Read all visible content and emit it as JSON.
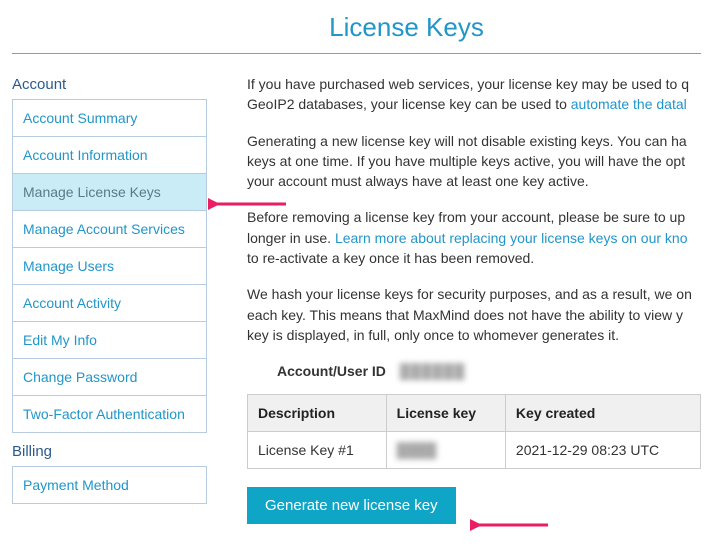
{
  "page": {
    "title": "License Keys"
  },
  "sidebar": {
    "sections": [
      {
        "label": "Account",
        "items": [
          {
            "label": "Account Summary",
            "active": false
          },
          {
            "label": "Account Information",
            "active": false
          },
          {
            "label": "Manage License Keys",
            "active": true
          },
          {
            "label": "Manage Account Services",
            "active": false
          },
          {
            "label": "Manage Users",
            "active": false
          },
          {
            "label": "Account Activity",
            "active": false
          },
          {
            "label": "Edit My Info",
            "active": false
          },
          {
            "label": "Change Password",
            "active": false
          },
          {
            "label": "Two-Factor Authentication",
            "active": false
          }
        ]
      },
      {
        "label": "Billing",
        "items": [
          {
            "label": "Payment Method",
            "active": false
          }
        ]
      }
    ]
  },
  "content": {
    "p1_a": "If you have purchased web services, your license key may be used to q",
    "p1_b": "GeoIP2 databases, your license key can be used to ",
    "p1_link": "automate the datal",
    "p2": "Generating a new license key will not disable existing keys. You can ha keys at one time. If you have multiple keys active, you will have the opt your account must always have at least one key active.",
    "p3_a": "Before removing a license key from your account, please be sure to up longer in use. ",
    "p3_link": "Learn more about replacing your license keys on our kno",
    "p3_b": " to re-activate a key once it has been removed.",
    "p4": "We hash your license keys for security purposes, and as a result, we on each key. This means that MaxMind does not have the ability to view y key is displayed, in full, only once to whomever generates it.",
    "account_id_label": "Account/User ID",
    "account_id_value": "██████",
    "table": {
      "headers": {
        "desc": "Description",
        "key": "License key",
        "created": "Key created"
      },
      "rows": [
        {
          "desc": "License Key #1",
          "key": "████",
          "created": "2021-12-29 08:23 UTC"
        }
      ]
    },
    "generate_button": "Generate new license key"
  }
}
